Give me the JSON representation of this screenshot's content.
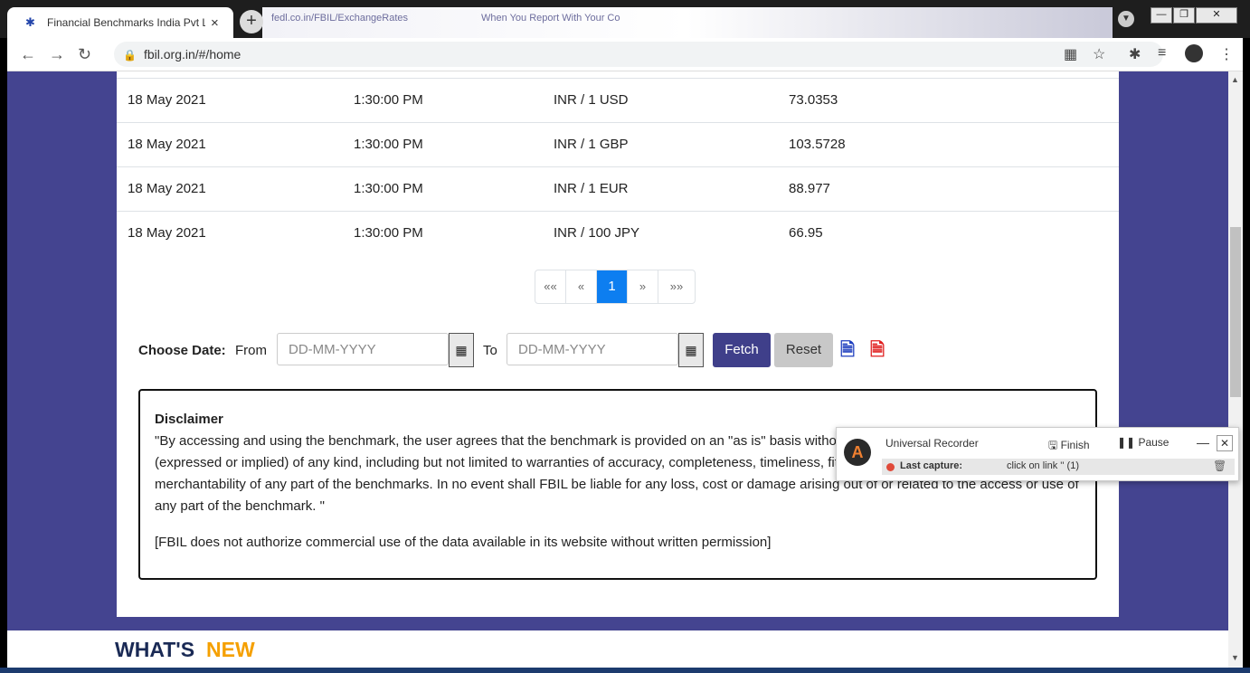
{
  "browser": {
    "active_tab_title": "Financial Benchmarks India Pvt Lt",
    "bg_tab_1": "fedl.co.in/FBIL/ExchangeRates",
    "bg_tab_2": "When You Report With Your Co",
    "url": "fbil.org.in/#/home",
    "icons": {
      "back": "←",
      "forward": "→",
      "reload": "↻",
      "lock": "🔒",
      "apps": "▦",
      "star": "☆",
      "extensions": "✱",
      "playlist": "≡",
      "menu": "⋮"
    }
  },
  "rates_table": {
    "rows": [
      {
        "date": "18 May 2021",
        "time": "1:30:00 PM",
        "currency": "INR / 1 USD",
        "rate": "73.0353"
      },
      {
        "date": "18 May 2021",
        "time": "1:30:00 PM",
        "currency": "INR / 1 GBP",
        "rate": "103.5728"
      },
      {
        "date": "18 May 2021",
        "time": "1:30:00 PM",
        "currency": "INR / 1 EUR",
        "rate": "88.977"
      },
      {
        "date": "18 May 2021",
        "time": "1:30:00 PM",
        "currency": "INR / 100 JPY",
        "rate": "66.95"
      }
    ]
  },
  "pagination": {
    "first": "««",
    "prev": "«",
    "current": "1",
    "next": "»",
    "last": "»»"
  },
  "date_filter": {
    "label": "Choose Date:",
    "from_label": "From",
    "to_label": "To",
    "from_placeholder": "DD-MM-YYYY",
    "to_placeholder": "DD-MM-YYYY",
    "fetch": "Fetch",
    "reset": "Reset"
  },
  "disclaimer": {
    "heading": "Disclaimer",
    "body": "\"By accessing and using the benchmark, the user agrees that the benchmark is provided on an \"as is\" basis without any representation or warranty (expressed or implied) of any kind, including but not limited to warranties of accuracy, completeness, timeliness, fitness for any particular purpose or merchantability of any part of the benchmarks. In no event shall FBIL be liable for any loss, cost or damage arising out of or related to the access or use of any part of the benchmark. \"",
    "note": "[FBIL does not authorize commercial use of the data available in its website without written permission]"
  },
  "whats_new": {
    "part1": "WHAT'S",
    "part2": "NEW"
  },
  "recorder": {
    "title": "Universal Recorder",
    "finish": "Finish",
    "pause": "Pause",
    "last_capture_label": "Last capture:",
    "last_capture_value": "click on link '' (1)"
  },
  "colors": {
    "page_bg": "#444490",
    "fetch_bg": "#3f3f8a",
    "active_page": "#0d7ef0",
    "brand_dark": "#1a2a55",
    "brand_orange": "#f5a000"
  }
}
